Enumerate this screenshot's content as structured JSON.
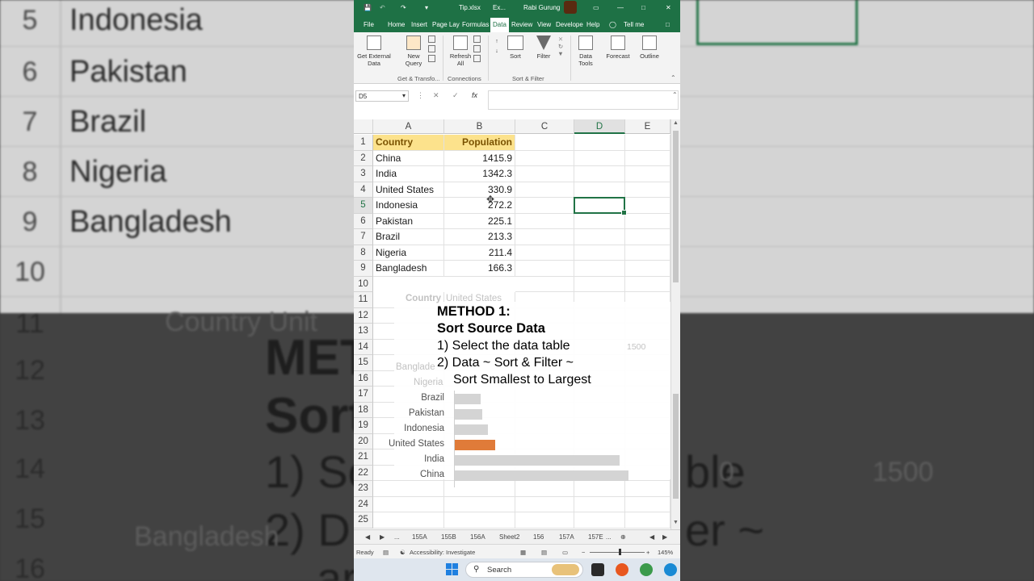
{
  "window": {
    "file_name": "Tip.xlsx",
    "app_suffix": "Ex...",
    "user": "Rabi Gurung"
  },
  "menu": [
    "File",
    "Home",
    "Insert",
    "Page Lay",
    "Formulas",
    "Data",
    "Review",
    "View",
    "Develope",
    "Help",
    "Tell me"
  ],
  "ribbon": {
    "get_external_data": "Get External\nData",
    "new_query": "New\nQuery",
    "refresh_all": "Refresh\nAll",
    "sort": "Sort",
    "filter": "Filter",
    "data_tools": "Data\nTools",
    "forecast": "Forecast",
    "outline": "Outline",
    "group_get_transform": "Get & Transfo...",
    "group_connections": "Connections",
    "group_sort_filter": "Sort & Filter"
  },
  "formula_bar": {
    "name_box": "D5",
    "fx": "fx"
  },
  "columns": [
    "A",
    "B",
    "C",
    "D",
    "E"
  ],
  "rows": [
    "1",
    "2",
    "3",
    "4",
    "5",
    "6",
    "7",
    "8",
    "9",
    "10",
    "11",
    "12",
    "13",
    "14",
    "15",
    "16",
    "17",
    "18",
    "19",
    "20",
    "21",
    "22",
    "23",
    "24",
    "25"
  ],
  "table": {
    "headers": [
      "Country",
      "Population"
    ],
    "rows": [
      [
        "China",
        "1415.9"
      ],
      [
        "India",
        "1342.3"
      ],
      [
        "United States",
        "330.9"
      ],
      [
        "Indonesia",
        "272.2"
      ],
      [
        "Pakistan",
        "225.1"
      ],
      [
        "Brazil",
        "213.3"
      ],
      [
        "Nigeria",
        "211.4"
      ],
      [
        "Bangladesh",
        "166.3"
      ]
    ]
  },
  "ghost_text": {
    "country": "Country",
    "united_states": "United States",
    "bangladesh": "Banglade",
    "nigeria": "Nigeria",
    "axis_max": "1500"
  },
  "instructions": {
    "line1": "METHOD 1:",
    "line2": "Sort Source Data",
    "line3": "1) Select the data table",
    "line4": "2) Data ~ Sort & Filter ~",
    "line5": "Sort Smallest to Largest"
  },
  "chart_data": {
    "type": "bar",
    "orientation": "horizontal",
    "categories": [
      "Brazil",
      "Pakistan",
      "Indonesia",
      "United States",
      "India",
      "China"
    ],
    "values": [
      213.3,
      225.1,
      272.2,
      330.9,
      1342.3,
      1415.9
    ],
    "highlight": "United States",
    "highlight_color": "#e07b39",
    "bar_color": "#d4d4d4",
    "xlim": [
      0,
      1500
    ]
  },
  "sheet_tabs": [
    "...",
    "155A",
    "155B",
    "156A",
    "Sheet2",
    "156",
    "157A",
    "157E",
    "..."
  ],
  "status": {
    "ready": "Ready",
    "accessibility": "Accessibility: Investigate",
    "zoom": "145%"
  },
  "taskbar": {
    "search_placeholder": "Search"
  },
  "background": {
    "rows": [
      {
        "num": "5",
        "text": "Indonesia"
      },
      {
        "num": "6",
        "text": "Pakistan"
      },
      {
        "num": "7",
        "text": "Brazil"
      },
      {
        "num": "8",
        "text": "Nigeria"
      },
      {
        "num": "9",
        "text": "Bangladesh"
      },
      {
        "num": "10",
        "text": ""
      }
    ],
    "lower_nums": [
      "11",
      "12",
      "13",
      "14",
      "15",
      "16"
    ],
    "country_united": "Country  Unit",
    "met": "METI",
    "sort": "Sort",
    "step1_a": "1) So",
    "step1_b": "ble",
    "step2_a": "2) D",
    "step2_b": "er ~",
    "step3": "argest",
    "bangladesh": "Bangladesh",
    "nigeria": "Nigeria",
    "val_1500": "1500"
  }
}
